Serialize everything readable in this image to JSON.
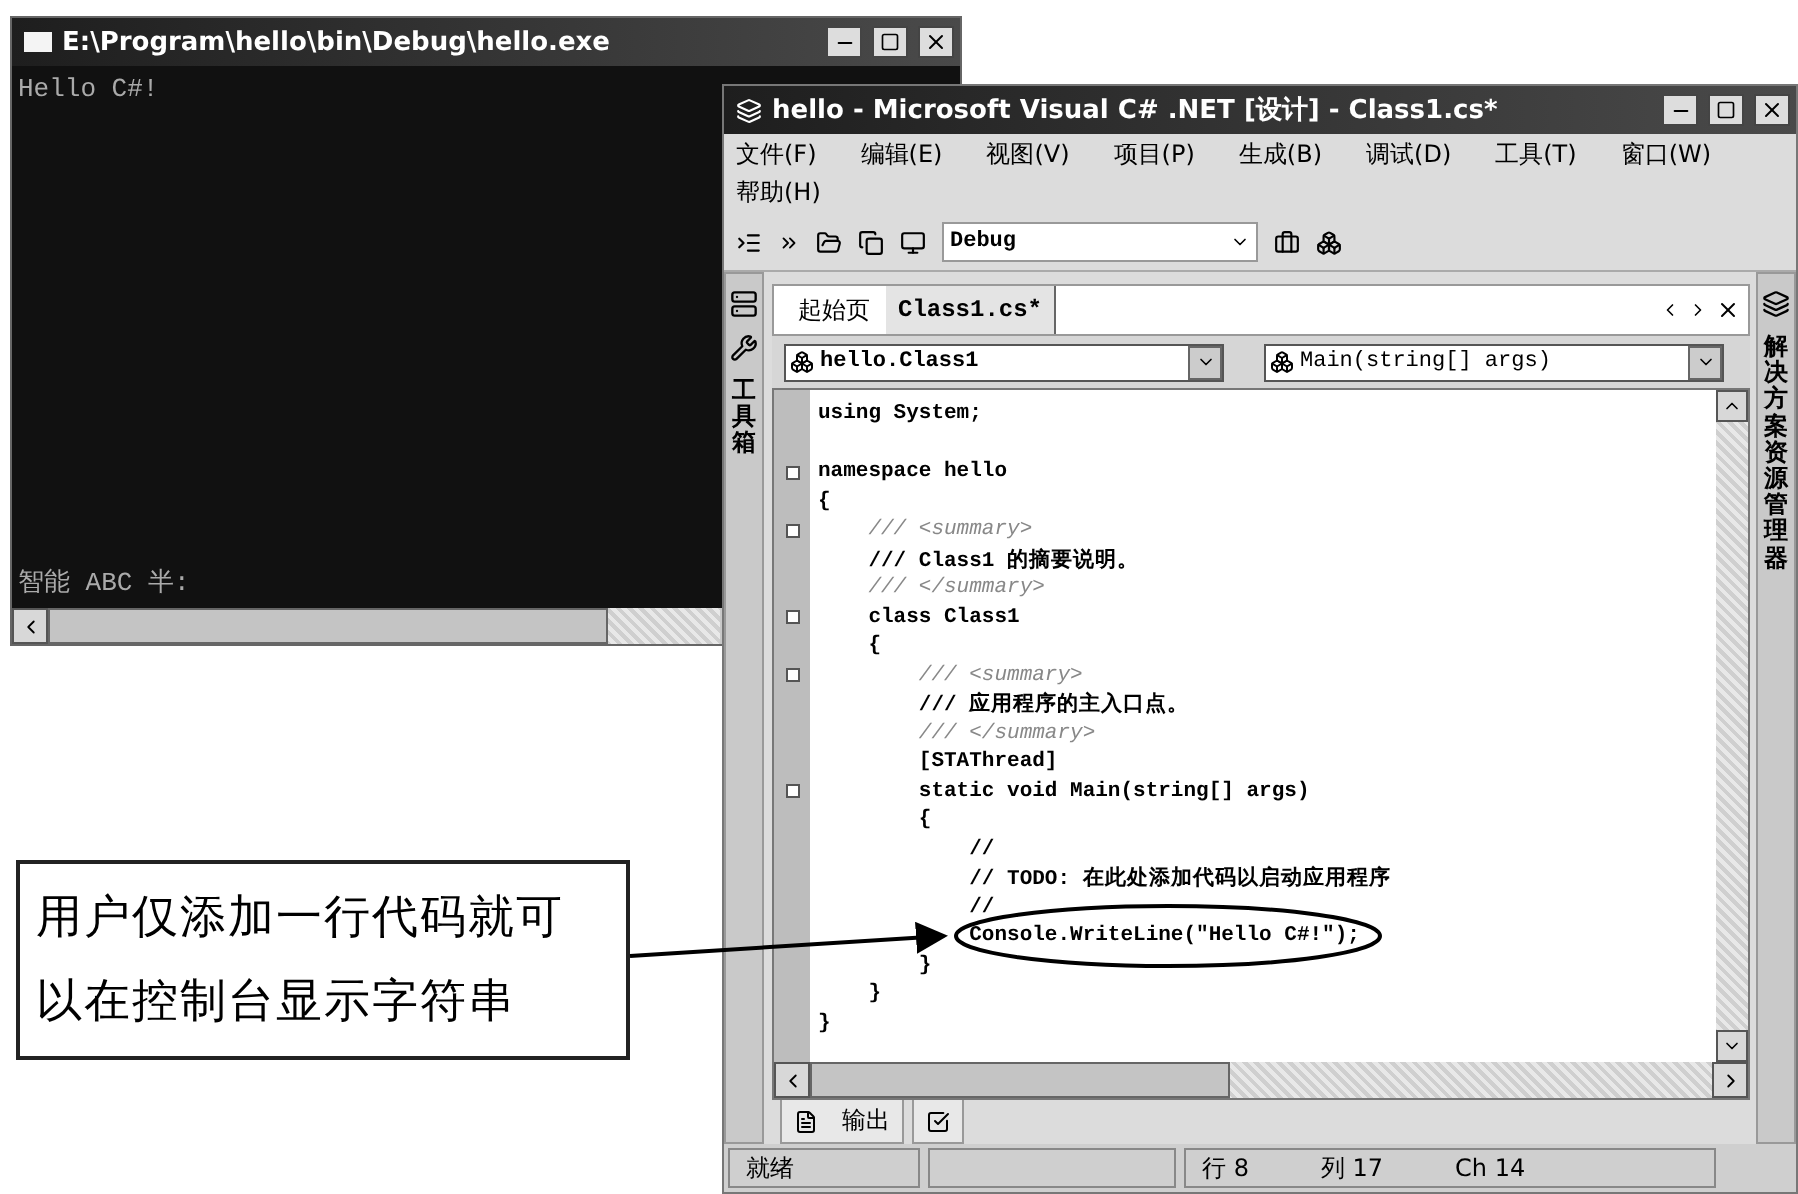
{
  "console": {
    "title": "E:\\Program\\hello\\bin\\Debug\\hello.exe",
    "output": "Hello C#!",
    "ime_bar": "智能 ABC 半:"
  },
  "ide": {
    "title": "hello - Microsoft Visual C# .NET [设计] - Class1.cs*",
    "menu": [
      "文件(F)",
      "编辑(E)",
      "视图(V)",
      "项目(P)",
      "生成(B)",
      "调试(D)",
      "工具(T)",
      "窗口(W)",
      "帮助(H)"
    ],
    "toolbar": {
      "configuration": "Debug"
    },
    "toolbox_label": "工具箱",
    "solution_label": "解决方案资源管理器",
    "tabs": [
      {
        "label": "起始页",
        "selected": false
      },
      {
        "label": "Class1.cs*",
        "selected": true
      }
    ],
    "type_dropdown": "hello.Class1",
    "member_dropdown": "Main(string[] args)",
    "code": [
      {
        "kind": "code",
        "text": "using System;",
        "fold": false
      },
      {
        "kind": "blank",
        "fold": false
      },
      {
        "kind": "code",
        "text": "namespace hello",
        "fold": true
      },
      {
        "kind": "code",
        "text": "{",
        "fold": false
      },
      {
        "kind": "xml",
        "text": "    /// <summary>",
        "fold": true
      },
      {
        "kind": "code",
        "text": "    /// Class1 的摘要说明。",
        "fold": false
      },
      {
        "kind": "xml",
        "text": "    /// </summary>",
        "fold": false
      },
      {
        "kind": "code",
        "text": "    class Class1",
        "fold": true
      },
      {
        "kind": "code",
        "text": "    {",
        "fold": false
      },
      {
        "kind": "xml",
        "text": "        /// <summary>",
        "fold": true
      },
      {
        "kind": "code",
        "text": "        /// 应用程序的主入口点。",
        "fold": false
      },
      {
        "kind": "xml",
        "text": "        /// </summary>",
        "fold": false
      },
      {
        "kind": "code",
        "text": "        [STAThread]",
        "fold": false
      },
      {
        "kind": "code",
        "text": "        static void Main(string[] args)",
        "fold": true
      },
      {
        "kind": "code",
        "text": "        {",
        "fold": false
      },
      {
        "kind": "code",
        "text": "            //",
        "fold": false
      },
      {
        "kind": "code",
        "text": "            // TODO: 在此处添加代码以启动应用程序",
        "fold": false
      },
      {
        "kind": "code",
        "text": "            //",
        "fold": false
      },
      {
        "kind": "code",
        "text": "            Console.WriteLine(\"Hello C#!\");",
        "fold": false
      },
      {
        "kind": "code",
        "text": "        }",
        "fold": false
      },
      {
        "kind": "code",
        "text": "    }",
        "fold": false
      },
      {
        "kind": "code",
        "text": "}",
        "fold": false
      }
    ],
    "tool_tabs": [
      {
        "kind": "output",
        "label": "输出"
      },
      {
        "kind": "tasks"
      }
    ],
    "status_bar": {
      "ready": "就绪",
      "position": [
        "行 8",
        "列 17",
        "Ch 14"
      ]
    }
  },
  "callout": {
    "text": "用户仅添加一行代码就可以在控制台显示字符串"
  }
}
